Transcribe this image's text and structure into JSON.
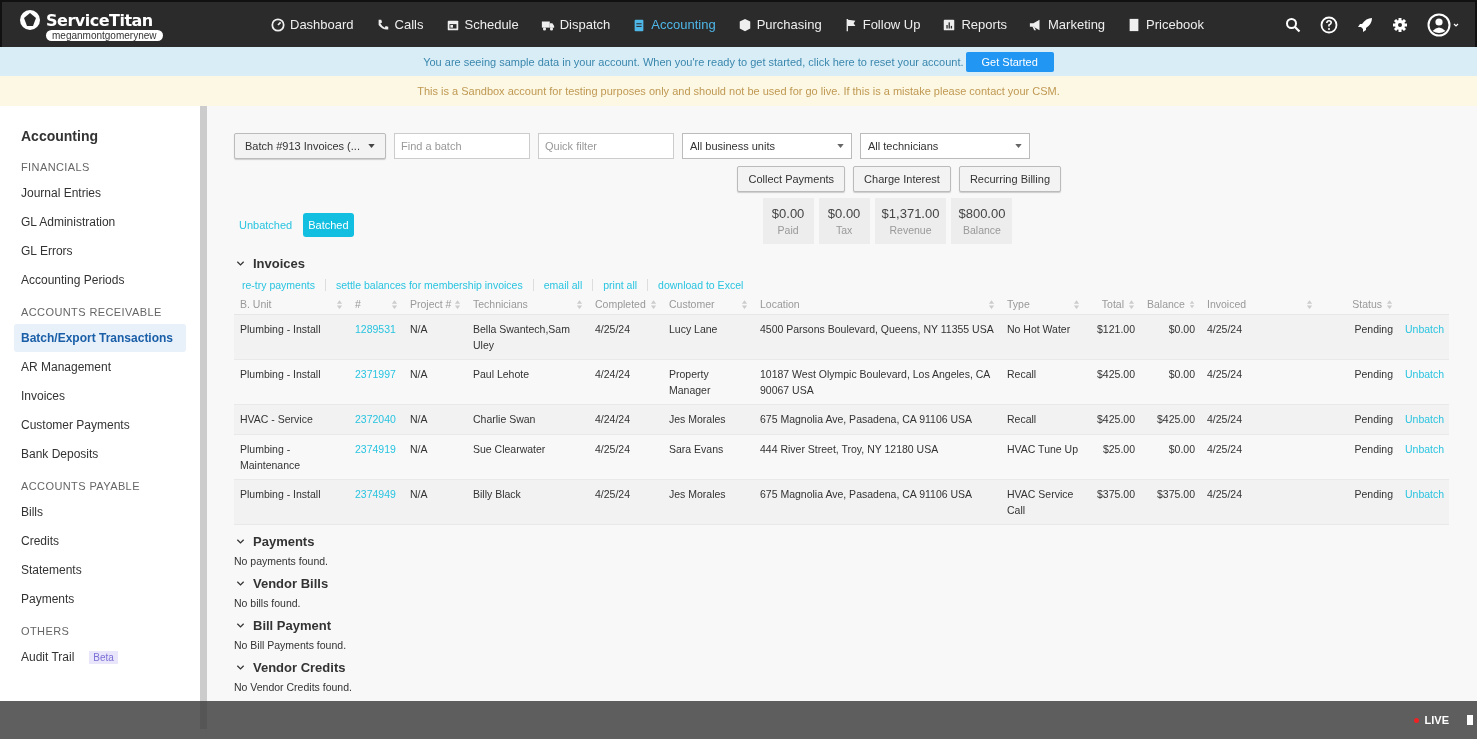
{
  "topbar": {
    "brand": "ServiceTitan",
    "account": "meganmontgomerynew",
    "nav": [
      {
        "label": "Dashboard",
        "selected": false
      },
      {
        "label": "Calls",
        "selected": false
      },
      {
        "label": "Schedule",
        "selected": false
      },
      {
        "label": "Dispatch",
        "selected": false
      },
      {
        "label": "Accounting",
        "selected": true
      },
      {
        "label": "Purchasing",
        "selected": false
      },
      {
        "label": "Follow Up",
        "selected": false
      },
      {
        "label": "Reports",
        "selected": false
      },
      {
        "label": "Marketing",
        "selected": false
      },
      {
        "label": "Pricebook",
        "selected": false
      }
    ]
  },
  "info_banner": {
    "text": "You are seeing sample data in your account. When you're ready to get started, click here to reset your account.",
    "button": "Get Started"
  },
  "warning_banner": {
    "text": "This is a Sandbox account for testing purposes only and should not be used for go live. If this is a mistake please contact your CSM."
  },
  "sidebar": {
    "title": "Accounting",
    "groups": [
      {
        "heading": "FINANCIALS",
        "items": [
          {
            "label": "Journal Entries",
            "selected": false
          },
          {
            "label": "GL Administration",
            "selected": false
          },
          {
            "label": "GL Errors",
            "selected": false
          },
          {
            "label": "Accounting Periods",
            "selected": false
          }
        ]
      },
      {
        "heading": "ACCOUNTS RECEIVABLE",
        "items": [
          {
            "label": "Batch/Export Transactions",
            "selected": true
          },
          {
            "label": "AR Management",
            "selected": false
          },
          {
            "label": "Invoices",
            "selected": false
          },
          {
            "label": "Customer Payments",
            "selected": false
          },
          {
            "label": "Bank Deposits",
            "selected": false
          }
        ]
      },
      {
        "heading": "ACCOUNTS PAYABLE",
        "items": [
          {
            "label": "Bills",
            "selected": false
          },
          {
            "label": "Credits",
            "selected": false
          },
          {
            "label": "Statements",
            "selected": false
          },
          {
            "label": "Payments",
            "selected": false
          }
        ]
      },
      {
        "heading": "OTHERS",
        "items": [
          {
            "label": "Audit Trail",
            "selected": false,
            "badge": "Beta"
          }
        ]
      }
    ]
  },
  "filters": {
    "batch_select": "Batch #913 Invoices (...",
    "find_placeholder": "Find a batch",
    "quick_placeholder": "Quick filter",
    "business_units": "All business units",
    "technicians": "All technicians"
  },
  "actions": [
    "Collect Payments",
    "Charge Interest",
    "Recurring Billing"
  ],
  "view_toggle": [
    {
      "label": "Unbatched",
      "selected": false
    },
    {
      "label": "Batched",
      "selected": true
    }
  ],
  "totals": [
    {
      "value": "$0.00",
      "label": "Paid"
    },
    {
      "value": "$0.00",
      "label": "Tax"
    },
    {
      "value": "$1,371.00",
      "label": "Revenue"
    },
    {
      "value": "$800.00",
      "label": "Balance"
    }
  ],
  "invoices": {
    "title": "Invoices",
    "expanded": true,
    "links": [
      "re-try payments",
      "settle balances for membership invoices",
      "email all",
      "print all",
      "download to Excel"
    ],
    "columns": [
      "B. Unit",
      "#",
      "Project #",
      "Technicians",
      "Completed",
      "Customer",
      "Location",
      "Type",
      "Total",
      "Balance",
      "Invoiced",
      "Status"
    ],
    "rows": [
      {
        "cells": [
          "Plumbing - Install",
          "1289531",
          "N/A",
          "Bella Swantech,Sam Uley",
          "4/25/24",
          "Lucy Lane",
          "4500 Parsons Boulevard, Queens, NY 11355 USA",
          "No Hot Water",
          "$121.00",
          "$0.00",
          "4/25/24",
          "Pending"
        ],
        "action": "Unbatch"
      },
      {
        "cells": [
          "Plumbing - Install",
          "2371997",
          "N/A",
          "Paul Lehote",
          "4/24/24",
          "Property Manager",
          "10187 West Olympic Boulevard, Los Angeles, CA 90067 USA",
          "Recall",
          "$425.00",
          "$0.00",
          "4/25/24",
          "Pending"
        ],
        "action": "Unbatch"
      },
      {
        "cells": [
          "HVAC - Service",
          "2372040",
          "N/A",
          "Charlie Swan",
          "4/24/24",
          "Jes Morales",
          "675 Magnolia Ave, Pasadena, CA 91106 USA",
          "Recall",
          "$425.00",
          "$425.00",
          "4/25/24",
          "Pending"
        ],
        "action": "Unbatch"
      },
      {
        "cells": [
          "Plumbing - Maintenance",
          "2374919",
          "N/A",
          "Sue Clearwater",
          "4/25/24",
          "Sara Evans",
          "444 River Street, Troy, NY 12180 USA",
          "HVAC Tune Up",
          "$25.00",
          "$0.00",
          "4/25/24",
          "Pending"
        ],
        "action": "Unbatch"
      },
      {
        "cells": [
          "Plumbing - Install",
          "2374949",
          "N/A",
          "Billy Black",
          "4/25/24",
          "Jes Morales",
          "675 Magnolia Ave, Pasadena, CA 91106 USA",
          "HVAC Service Call",
          "$375.00",
          "$375.00",
          "4/25/24",
          "Pending"
        ],
        "action": "Unbatch"
      }
    ]
  },
  "sections": [
    {
      "title": "Payments",
      "expanded": true,
      "empty": "No payments found."
    },
    {
      "title": "Vendor Bills",
      "expanded": true,
      "empty": "No bills found."
    },
    {
      "title": "Bill Payment",
      "expanded": true,
      "empty": "No Bill Payments found."
    },
    {
      "title": "Vendor Credits",
      "expanded": true,
      "empty": "No Vendor Credits found."
    }
  ],
  "player_bar": {
    "live_label": "LIVE"
  }
}
